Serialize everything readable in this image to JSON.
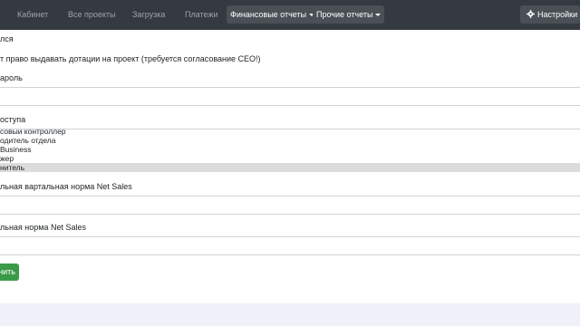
{
  "navbar": {
    "links": [
      "Кабинет",
      "Все проекты",
      "Загрузка",
      "Платежи"
    ],
    "financial_reports": "Финансовые отчеты",
    "other_reports": "Прочие отчеты",
    "settings": "Настройки"
  },
  "form": {
    "label_top": "лся",
    "subsidy_right": "т право выдавать дотации на проект (требуется согласование CEO!)",
    "password_label": "ароль",
    "access_label": "оступа",
    "roles": [
      "совый контроллер",
      "одитель отдела",
      "Business",
      "жер",
      "нитель"
    ],
    "quarterly_label": "льная вартальная норма Net Sales",
    "norm_label": "льная норма Net Sales",
    "save_button": "нить"
  },
  "colors": {
    "navbar_bg": "#343a40",
    "success": "#3a9a47",
    "selected_row": "#dcdcdc"
  }
}
